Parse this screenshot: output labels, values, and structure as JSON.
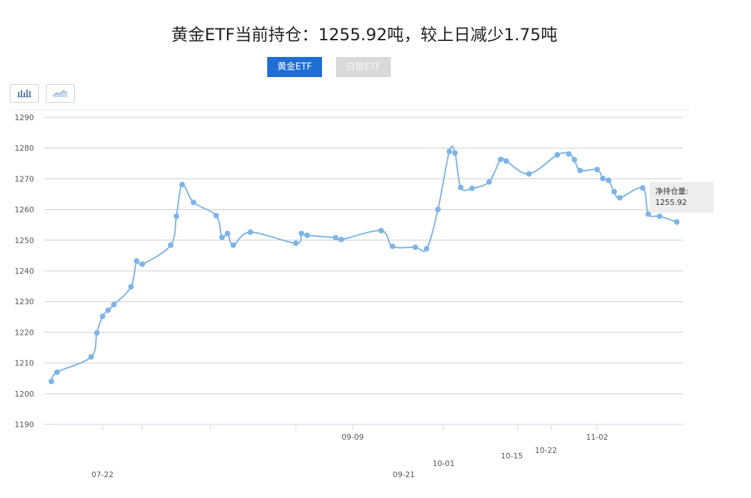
{
  "title": "黄金ETF当前持仓：1255.92吨，较上日减少1.75吨",
  "tabs": [
    {
      "label": "黄金ETF",
      "active": true
    },
    {
      "label": "白银ETF",
      "active": false
    }
  ],
  "tools": [
    {
      "icon": "bar-chart-icon"
    },
    {
      "icon": "line-chart-icon"
    }
  ],
  "tooltip": {
    "label": "净持仓量:",
    "value": "1255.92"
  },
  "colors": {
    "line": "#7db4e6",
    "accent": "#1f6ed3",
    "grid": "#cccccc"
  },
  "chart_data": {
    "type": "line",
    "ylim": [
      1190,
      1290
    ],
    "yticks": [
      1190,
      1200,
      1210,
      1220,
      1230,
      1240,
      1250,
      1260,
      1270,
      1280,
      1290
    ],
    "x_labels": [
      {
        "text": "07-22",
        "i": 9,
        "row": 2
      },
      {
        "text": "09-09",
        "i": 53,
        "row": 0
      },
      {
        "text": "09-21",
        "i": 62,
        "row": 2
      },
      {
        "text": "10-01",
        "i": 69,
        "row": 1.4
      },
      {
        "text": "10-15",
        "i": 81,
        "row": 1
      },
      {
        "text": "10-22",
        "i": 87,
        "row": 0.7
      },
      {
        "text": "11-02",
        "i": 96,
        "row": 0
      }
    ],
    "minor_ticks": [
      9,
      16,
      28,
      43,
      53,
      69,
      82,
      88,
      96
    ],
    "series": [
      {
        "values": [
          [
            0,
            1204.0
          ],
          [
            1,
            1207.0
          ],
          [
            7,
            1212.0
          ],
          [
            8,
            1219.8
          ],
          [
            9,
            1225.2
          ],
          [
            10,
            1227.2
          ],
          [
            11,
            1229.0
          ],
          [
            14,
            1234.8
          ],
          [
            15,
            1243.2
          ],
          [
            16,
            1242.2
          ],
          [
            21,
            1248.4
          ],
          [
            22,
            1257.8
          ],
          [
            23,
            1268.1
          ],
          [
            25,
            1262.3
          ],
          [
            29,
            1258.0
          ],
          [
            30,
            1250.9
          ],
          [
            31,
            1252.2
          ],
          [
            32,
            1248.4
          ],
          [
            35,
            1252.6
          ],
          [
            43,
            1249.0
          ],
          [
            44,
            1252.2
          ],
          [
            45,
            1251.6
          ],
          [
            50,
            1250.8
          ],
          [
            51,
            1250.2
          ],
          [
            58,
            1253.1
          ],
          [
            60,
            1248.0
          ],
          [
            64,
            1247.7
          ],
          [
            66,
            1247.2
          ],
          [
            68,
            1260.0
          ],
          [
            70,
            1278.9
          ],
          [
            71,
            1278.4
          ],
          [
            72,
            1267.2
          ],
          [
            74,
            1266.9
          ],
          [
            77,
            1269.0
          ],
          [
            79,
            1276.3
          ],
          [
            80,
            1275.8
          ],
          [
            84,
            1271.6
          ],
          [
            89,
            1277.8
          ],
          [
            91,
            1278.1
          ],
          [
            92,
            1276.2
          ],
          [
            93,
            1272.7
          ],
          [
            96,
            1273.0
          ],
          [
            97,
            1270.1
          ],
          [
            98,
            1269.5
          ],
          [
            99,
            1265.8
          ],
          [
            100,
            1263.8
          ],
          [
            104,
            1267.0
          ],
          [
            105,
            1258.5
          ],
          [
            107,
            1257.8
          ],
          [
            110,
            1255.92
          ]
        ]
      }
    ]
  }
}
